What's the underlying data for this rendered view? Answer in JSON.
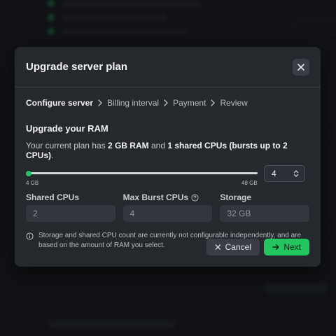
{
  "modal": {
    "title": "Upgrade server plan",
    "close_icon": "close-icon"
  },
  "breadcrumb": {
    "steps": [
      "Configure server",
      "Billing interval",
      "Payment",
      "Review"
    ],
    "active_index": 0
  },
  "ram": {
    "title": "Upgrade your RAM",
    "plan_prefix": "Your current plan has ",
    "plan_ram": "2 GB RAM",
    "plan_mid": " and ",
    "plan_cpu": "1 shared CPUs (bursts up to 2 CPUs)",
    "plan_suffix": ".",
    "slider_min_label": "4 GB",
    "slider_max_label": "48 GB",
    "slider_min": 4,
    "slider_max": 48,
    "slider_value": 4,
    "stepper_value": "4"
  },
  "fields": [
    {
      "label": "Shared CPUs",
      "value": "2"
    },
    {
      "label": "Max Burst CPUs",
      "value": "4",
      "help_icon": "help-circle-icon"
    },
    {
      "label": "Storage",
      "value": "32 GB"
    }
  ],
  "info_text": "Storage and shared CPU count are currently not configurable independently, and are based on the amount of RAM you select.",
  "actions": {
    "cancel_label": "Cancel",
    "next_label": "Next"
  },
  "colors": {
    "accent": "#22c55e",
    "modal_bg": "#25282d",
    "page_bg": "#15191d"
  }
}
